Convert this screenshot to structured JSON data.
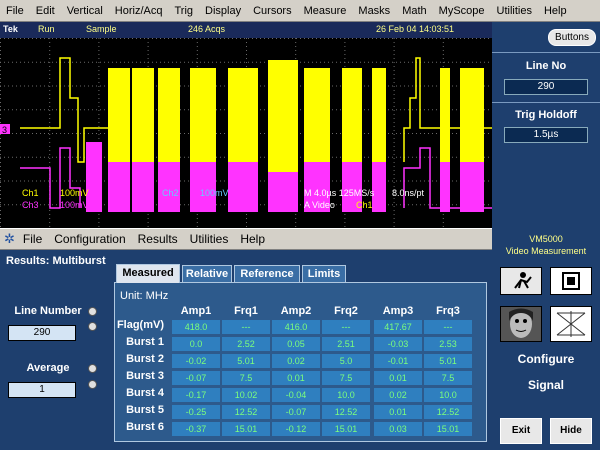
{
  "menubar": {
    "items": [
      "File",
      "Edit",
      "Vertical",
      "Horiz/Acq",
      "Trig",
      "Display",
      "Cursors",
      "Measure",
      "Masks",
      "Math",
      "MyScope",
      "Utilities",
      "Help"
    ]
  },
  "status": {
    "brand": "Tek",
    "state": "Run",
    "mode": "Sample",
    "acqs": "246 Acqs",
    "datetime": "26 Feb 04 14:03:51"
  },
  "buttons_btn": "Buttons",
  "right": {
    "line_no_label": "Line No",
    "line_no_value": "290",
    "trig_label": "Trig Holdoff",
    "trig_value": "1.5µs"
  },
  "scope": {
    "ch1": "Ch1",
    "ch1_scale": "100mV",
    "ch2": "Ch2",
    "ch2_scale": "100mV",
    "ch3": "Ch3",
    "ch3_scale": "100mV",
    "timebase": "M 4.0µs 125MS/s",
    "pts": "8.0ns/pt",
    "trig_type": "A Video",
    "trig_src": "Ch1",
    "marker": "3",
    "colors": {
      "ch1": "#ffff00",
      "ch3": "#ff33ff",
      "grid": "#6a6a6a"
    }
  },
  "appmenu": {
    "items": [
      "File",
      "Configuration",
      "Results",
      "Utilities",
      "Help"
    ]
  },
  "left": {
    "title": "Results: Multiburst",
    "line_number_label": "Line Number",
    "line_number_value": "290",
    "average_label": "Average",
    "average_value": "1"
  },
  "tabs": [
    "Measured",
    "Relative",
    "Reference",
    "Limits"
  ],
  "table": {
    "unit": "Unit: MHz",
    "headers": [
      "Amp1",
      "Frq1",
      "Amp2",
      "Frq2",
      "Amp3",
      "Frq3"
    ],
    "rows": [
      {
        "label": "Flag(mV)",
        "cells": [
          "418.0",
          "---",
          "416.0",
          "---",
          "417.67",
          "---"
        ]
      },
      {
        "label": "Burst 1",
        "cells": [
          "0.0",
          "2.52",
          "0.05",
          "2.51",
          "-0.03",
          "2.53"
        ]
      },
      {
        "label": "Burst 2",
        "cells": [
          "-0.02",
          "5.01",
          "0.02",
          "5.0",
          "-0.01",
          "5.01"
        ]
      },
      {
        "label": "Burst 3",
        "cells": [
          "-0.07",
          "7.5",
          "0.01",
          "7.5",
          "0.01",
          "7.5"
        ]
      },
      {
        "label": "Burst 4",
        "cells": [
          "-0.17",
          "10.02",
          "-0.04",
          "10.0",
          "0.02",
          "10.0"
        ]
      },
      {
        "label": "Burst 5",
        "cells": [
          "-0.25",
          "12.52",
          "-0.07",
          "12.52",
          "0.01",
          "12.52"
        ]
      },
      {
        "label": "Burst 6",
        "cells": [
          "-0.37",
          "15.01",
          "-0.12",
          "15.01",
          "0.03",
          "15.01"
        ]
      }
    ]
  },
  "vm": {
    "title": "VM5000",
    "subtitle": "Video Measurement",
    "configure": "Configure",
    "signal": "Signal",
    "exit": "Exit",
    "hide": "Hide"
  }
}
